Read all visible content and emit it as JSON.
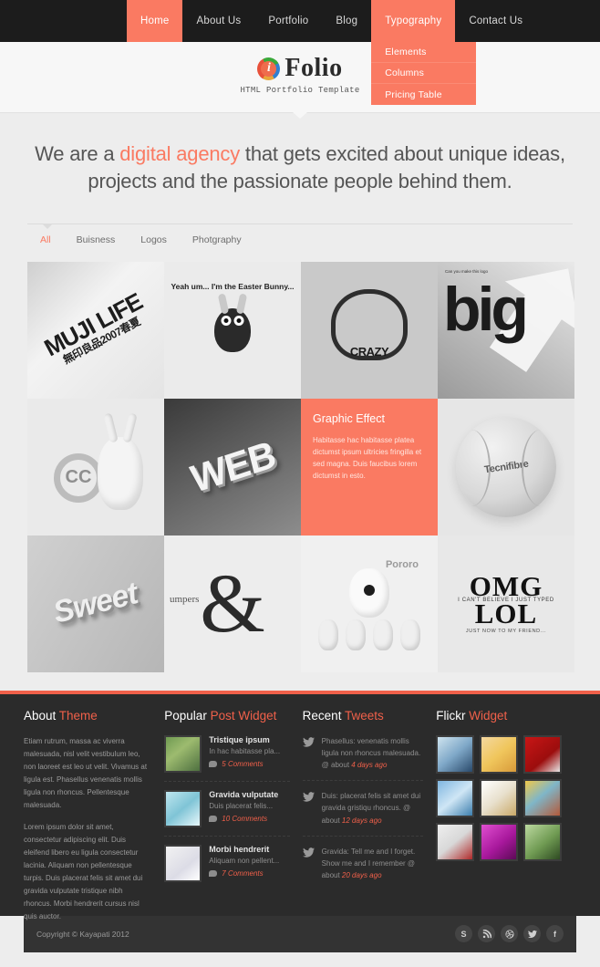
{
  "nav": {
    "items": [
      {
        "label": "Home",
        "state": "active"
      },
      {
        "label": "About Us",
        "state": "normal"
      },
      {
        "label": "Portfolio",
        "state": "normal"
      },
      {
        "label": "Blog",
        "state": "normal"
      },
      {
        "label": "Typography",
        "state": "open"
      },
      {
        "label": "Contact Us",
        "state": "normal"
      }
    ],
    "dropdown": {
      "parent": "Typography",
      "items": [
        "Elements",
        "Columns",
        "Pricing Table"
      ]
    }
  },
  "logo": {
    "mark_letter": "i",
    "text": "Folio",
    "tagline": "HTML Portfolio Template"
  },
  "hero": {
    "line1_pre": "We are a ",
    "line1_accent": "digital agency",
    "line1_post": " that gets excited about unique ideas, projects and",
    "line2": "the passionate people behind them."
  },
  "filters": [
    {
      "label": "All",
      "active": true
    },
    {
      "label": "Buisness",
      "active": false
    },
    {
      "label": "Logos",
      "active": false
    },
    {
      "label": "Photgraphy",
      "active": false
    }
  ],
  "portfolio": {
    "tiles": [
      {
        "kind": "image",
        "name": "muji-life",
        "caption": "MUJI LIFE",
        "caption2": "無印良品2007春夏"
      },
      {
        "kind": "image",
        "name": "easter-bunny",
        "caption": "Yeah um... I'm the Easter Bunny..."
      },
      {
        "kind": "image",
        "name": "crazy-artwork",
        "caption": "CRAZY"
      },
      {
        "kind": "image",
        "name": "big-typography",
        "caption": "big",
        "caption2": "Can you make this logo"
      },
      {
        "kind": "image",
        "name": "creative-commons-rabbit",
        "caption": "CC"
      },
      {
        "kind": "image",
        "name": "web-3d-letters",
        "caption": "WEB"
      },
      {
        "kind": "info",
        "name": "graphic-effect",
        "title": "Graphic Effect",
        "text": "Habitasse hac habitasse platea dictumst ipsum ultricies fringilla et sed magna. Duis faucibus lorem dictumst in esto."
      },
      {
        "kind": "image",
        "name": "tennis-ball",
        "caption": "Tecnifibre"
      },
      {
        "kind": "image",
        "name": "sweet-3d-letters",
        "caption": "Sweet"
      },
      {
        "kind": "image",
        "name": "ampersand-cable",
        "caption": "&",
        "caption2": "umpers"
      },
      {
        "kind": "image",
        "name": "pororo-characters",
        "caption": "Pororo"
      },
      {
        "kind": "image",
        "name": "omg-lol-typewriter",
        "caption": "OMG",
        "caption2": "I CAN'T BELIEVE I JUST TYPED",
        "caption3": "LOL",
        "caption4": "JUST NOW TO MY FRIEND..."
      }
    ]
  },
  "footer": {
    "about": {
      "title_1": "About ",
      "title_2": "Theme",
      "p1": "Etiam rutrum, massa ac viverra malesuada, nisl velit vestibulum leo, non laoreet est leo ut velit. Vivamus at ligula est. Phasellus venenatis mollis ligula non rhoncus. Pellentesque malesuada.",
      "p2": "Lorem ipsum dolor sit amet, consectetur adipiscing elit. Duis eleifend libero eu ligula consectetur lacinia. Aliquam non pellentesque turpis. Duis placerat felis sit amet dui gravida vulputate tristique nibh rhoncus. Morbi hendrerit cursus nisl quis auctor."
    },
    "popular": {
      "title_1": "Popular ",
      "title_2": "Post Widget",
      "posts": [
        {
          "title": "Tristique ipsum",
          "excerpt": "In hac habitasse pla...",
          "comments": "5 Comments"
        },
        {
          "title": "Gravida vulputate",
          "excerpt": "Duis placerat felis...",
          "comments": "10 Comments"
        },
        {
          "title": "Morbi hendrerit",
          "excerpt": "Aliquam non pellent...",
          "comments": "7 Comments"
        }
      ]
    },
    "tweets": {
      "title_1": "Recent ",
      "title_2": "Tweets",
      "items": [
        {
          "text": "Phasellus: venenatis mollis ligula non rhoncus malesuada. @ about ",
          "ago": "4 days ago"
        },
        {
          "text": "Duis: placerat felis sit amet dui gravida gristiqu rhoncus. @ about ",
          "ago": "12 days ago"
        },
        {
          "text": "Gravida: Tell me and I forget. Show me and I remember @ about ",
          "ago": "20 days ago"
        }
      ]
    },
    "flickr": {
      "title_1": "Flickr ",
      "title_2": "Widget",
      "photos": [
        "flickr-photo-1",
        "flickr-photo-2",
        "flickr-photo-3",
        "flickr-photo-4",
        "flickr-photo-5",
        "flickr-photo-6",
        "flickr-photo-7",
        "flickr-photo-8",
        "flickr-photo-9"
      ]
    },
    "copyright": "Copyright © Kayapati 2012",
    "social": [
      {
        "name": "skype",
        "glyph": "S"
      },
      {
        "name": "rss",
        "glyph": "◜"
      },
      {
        "name": "dribbble",
        "glyph": "Ⓓ"
      },
      {
        "name": "twitter",
        "glyph": "t"
      },
      {
        "name": "facebook",
        "glyph": "f"
      }
    ]
  },
  "colors": {
    "accent": "#fa7a62",
    "accent_dark": "#f0604a",
    "nav_bg": "#1c1c1c",
    "footer_bg": "#2b2b2b",
    "page_bg": "#ededed"
  }
}
